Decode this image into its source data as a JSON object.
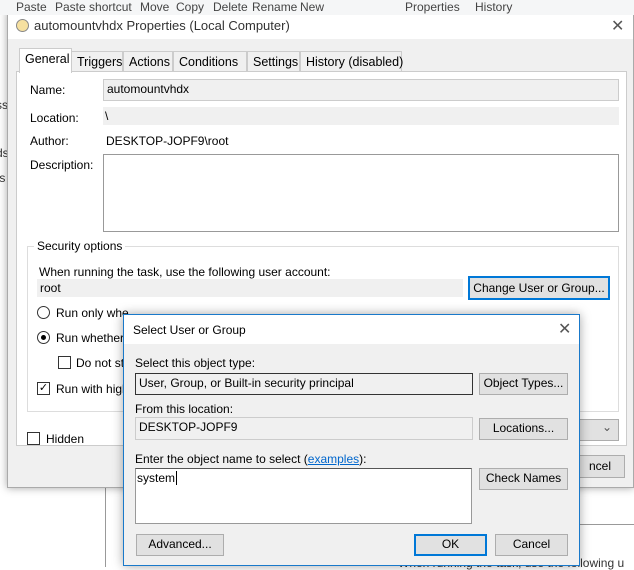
{
  "ribbon": {
    "items": [
      "Paste",
      "Paste shortcut",
      "Move",
      "Copy",
      "Delete",
      "Rename",
      "New",
      "Properties",
      "History"
    ]
  },
  "background": {
    "fragments": [
      "ss",
      "ds",
      "ts"
    ]
  },
  "properties": {
    "title": "automountvhdx Properties (Local Computer)",
    "tabs": [
      "General",
      "Triggers",
      "Actions",
      "Conditions",
      "Settings",
      "History (disabled)"
    ],
    "active_tab": "General",
    "name_label": "Name:",
    "name_value": "automountvhdx",
    "location_label": "Location:",
    "location_value": "\\",
    "author_label": "Author:",
    "author_value": "DESKTOP-JOPF9\\root",
    "description_label": "Description:",
    "description_value": "",
    "security": {
      "title": "Security options",
      "account_prompt": "When running the task, use the following user account:",
      "account_value": "root",
      "change_button": "Change User or Group...",
      "run_only_label": "Run only whe",
      "run_whether_label": "Run whether",
      "do_not_store_label": "Do not st",
      "run_highest_label": "Run with high",
      "run_mode": "run_whether",
      "do_not_store_checked": false,
      "run_highest_checked": true
    },
    "hidden_label": "Hidden",
    "hidden_checked": false,
    "cancel_button_partial": "ncel"
  },
  "select_dialog": {
    "title": "Select User or Group",
    "object_type_label": "Select this object type:",
    "object_type_value": "User, Group, or Built-in security principal",
    "object_types_button": "Object Types...",
    "location_label": "From this location:",
    "location_value": "DESKTOP-JOPF9",
    "locations_button": "Locations...",
    "enter_label_pre": "Enter the object name to select (",
    "examples_link": "examples",
    "enter_label_post": "):",
    "object_name_value": "system",
    "check_names_button": "Check Names",
    "advanced_button": "Advanced...",
    "ok_button": "OK",
    "cancel_button": "Cancel"
  },
  "background_bottom_text": "When running the task, use the following u"
}
